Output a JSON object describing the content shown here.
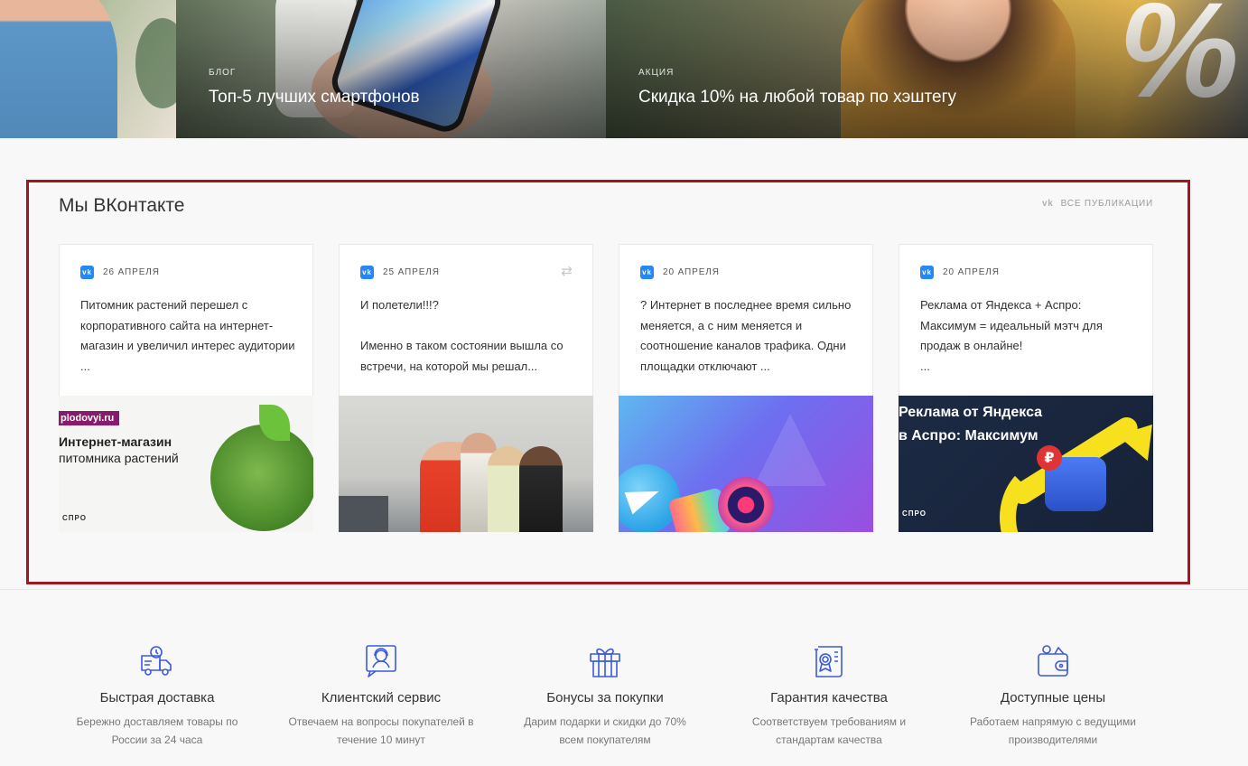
{
  "banners": [
    {
      "tag": "",
      "title": ""
    },
    {
      "tag": "БЛОГ",
      "title": "Топ-5 лучших смартфонов"
    },
    {
      "tag": "АКЦИЯ",
      "title": "Скидка 10% на любой товар по хэштегу"
    }
  ],
  "banner_art": {
    "percent_glyph": "%"
  },
  "vk": {
    "title": "Мы ВКонтакте",
    "all_publications": "ВСЕ ПУБЛИКАЦИИ",
    "vk_logo": "vk",
    "posts": [
      {
        "date": "26 АПРЕЛЯ",
        "text": "Питомник растений перешел с корпоративного сайта на интернет-магазин и увеличил интерес аудитории ...",
        "image": {
          "chip": "plodovyi.ru",
          "line1": "Интернет-магазин",
          "line2": "питомника растений",
          "logo": "СПРО"
        }
      },
      {
        "date": "25 АПРЕЛЯ",
        "text": "И полетели!!!?\n\nИменно в таком состоянии вышла со встречи, на которой мы решал...",
        "repost": true
      },
      {
        "date": "20 АПРЕЛЯ",
        "text": "? Интернет в последнее время сильно меняется, а с ним меняется и соотношение каналов трафика. Одни площадки отключают ..."
      },
      {
        "date": "20 АПРЕЛЯ",
        "text": "Реклама от Яндекса + Аспро: Максимум = идеальный мэтч для продаж в онлайне!\n ...",
        "image": {
          "line1": "Реклама от Яндекса",
          "line2": "в Аспро: Максимум",
          "rub": "₽",
          "logo": "СПРО"
        }
      }
    ]
  },
  "features": [
    {
      "icon": "delivery-truck-icon",
      "title": "Быстрая доставка",
      "desc": "Бережно доставляем товары по России за 24 часа"
    },
    {
      "icon": "support-agent-icon",
      "title": "Клиентский сервис",
      "desc": "Отвечаем на вопросы покупателей в течение 10 минут"
    },
    {
      "icon": "gift-icon",
      "title": "Бонусы за покупки",
      "desc": "Дарим подарки и скидки до 70% всем покупателям"
    },
    {
      "icon": "certificate-icon",
      "title": "Гарантия качества",
      "desc": "Соответствуем требованиям и стандартам качества"
    },
    {
      "icon": "wallet-icon",
      "title": "Доступные цены",
      "desc": "Работаем напрямую с ведущими производителями"
    }
  ],
  "colors": {
    "accent": "#3b5bdb",
    "highlight_border": "#a4151f",
    "vk_blue": "#2787f5"
  }
}
